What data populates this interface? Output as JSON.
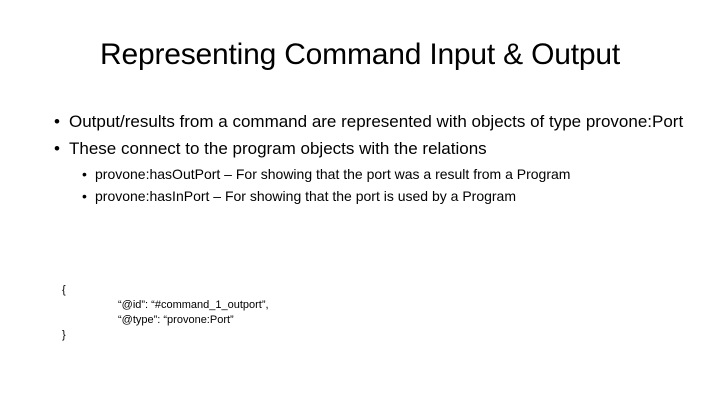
{
  "slide": {
    "title": "Representing Command Input & Output",
    "bullets": [
      {
        "marker": "•",
        "text": "Output/results from a command are represented with objects of type provone:Port"
      },
      {
        "marker": "•",
        "text": "These connect to the program objects with the relations",
        "subbullets": [
          {
            "marker": "•",
            "text": "provone:hasOutPort – For showing that the port was a result from a Program"
          },
          {
            "marker": "•",
            "text": "provone:hasInPort – For showing that the port is used by a Program"
          }
        ]
      }
    ],
    "code": {
      "open_brace": "{",
      "line1": "“@id”: “#command_1_outport”,",
      "line2": "“@type”: “provone:Port”",
      "close_brace": "}"
    }
  }
}
